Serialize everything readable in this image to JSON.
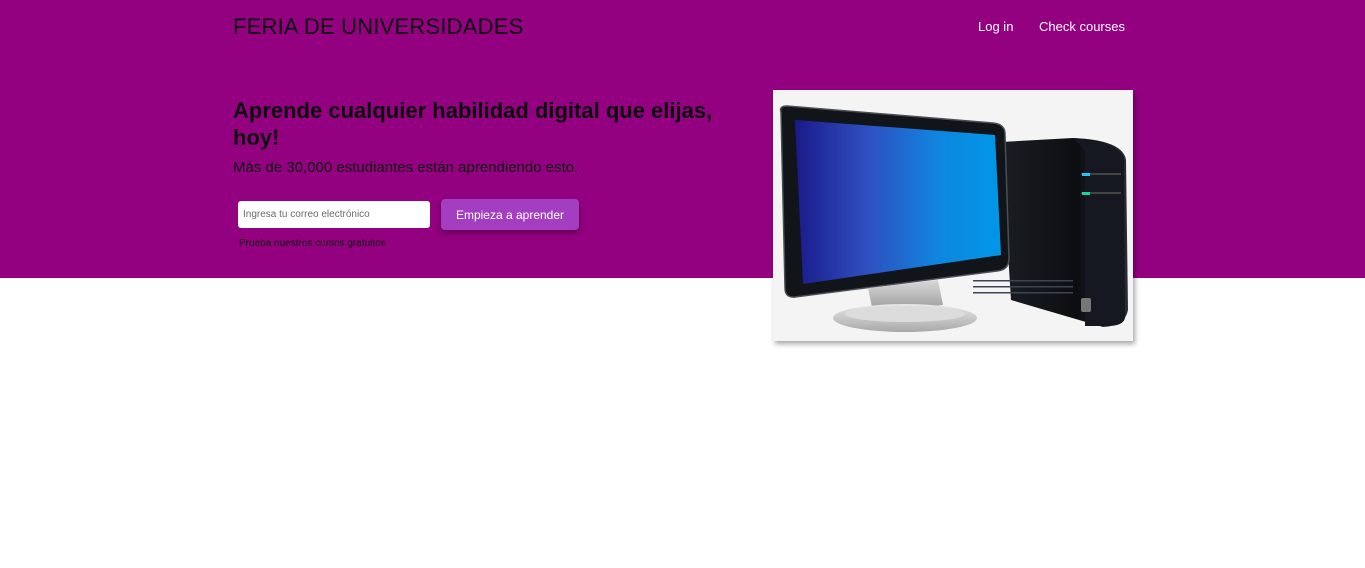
{
  "header": {
    "brand": "FERIA DE UNIVERSIDADES",
    "nav": {
      "login": "Log in",
      "courses": "Check courses"
    }
  },
  "hero": {
    "headline": "Aprende cualquier habilidad digital que elijas, hoy!",
    "subheadline": "Más de 30,000 estudiantes están aprendiendo esto.",
    "signup": {
      "email_placeholder": "Ingresa tu correo electrónico",
      "email_value": "",
      "button_label": "Empieza a aprender"
    },
    "free_courses_link": "Prueba nuestros cursos gratuitos",
    "image": {
      "icon": "desktop-computer-icon"
    }
  },
  "colors": {
    "hero_background": "#930080",
    "button": "#a43ec1",
    "nav_text": "#ffffff"
  }
}
